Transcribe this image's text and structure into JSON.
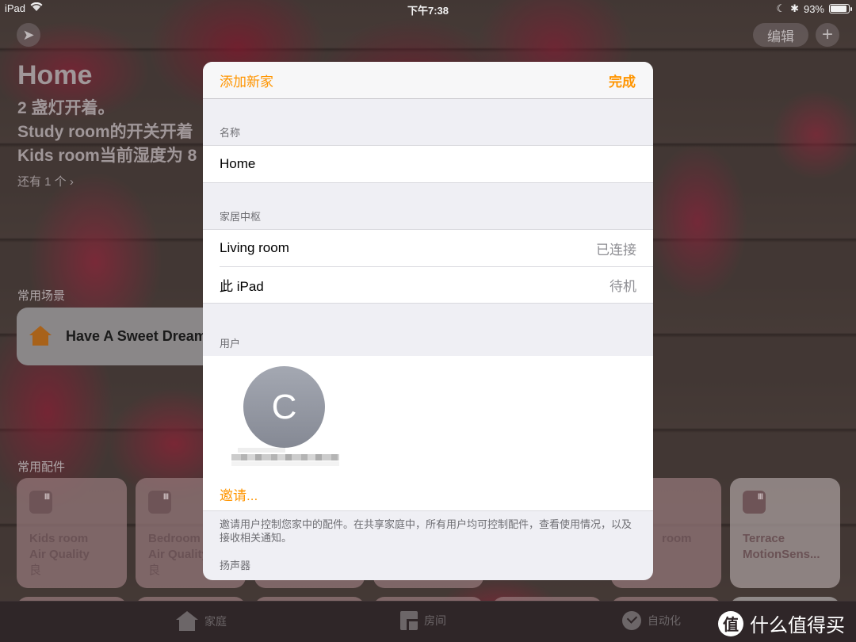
{
  "status_bar": {
    "device": "iPad",
    "time": "下午7:38",
    "battery_percent": "93%",
    "battery_level": 0.93
  },
  "home": {
    "edit_label": "编辑",
    "add_label": "+",
    "title": "Home",
    "summary": [
      "2 盏灯开着。",
      "Study room的开关开着",
      "Kids room当前湿度为 8"
    ],
    "more_label": "还有 1 个 ›",
    "scenes_header": "常用场景",
    "scenes": [
      {
        "label": "Have A Sweet Dream",
        "icon": "house-icon"
      }
    ],
    "accessories_header": "常用配件",
    "accessories": [
      {
        "name_line1": "Kids room",
        "name_line2": "Air Quality",
        "status": "良"
      },
      {
        "name_line1": "Bedroom",
        "name_line2": "Air Quality",
        "status": "良"
      },
      {
        "name_line1": "",
        "name_line2": "",
        "status": ""
      },
      {
        "name_line1": "",
        "name_line2": "",
        "status": ""
      },
      {
        "name_line1": "room",
        "name_line2": "",
        "status": ""
      },
      {
        "name_line1": "Terrace",
        "name_line2": "MotionSens...",
        "status": ""
      }
    ]
  },
  "tab_bar": {
    "tabs": [
      {
        "label": "家庭",
        "icon": "house-icon"
      },
      {
        "label": "房间",
        "icon": "room-icon"
      },
      {
        "label": "自动化",
        "icon": "automation-icon"
      }
    ],
    "watermark_badge": "值",
    "watermark_text": "什么值得买"
  },
  "modal": {
    "cancel_label": "添加新家",
    "done_label": "完成",
    "name_header": "名称",
    "name_value": "Home",
    "hub_header": "家居中枢",
    "hubs": [
      {
        "name": "Living room",
        "status": "已连接"
      },
      {
        "name": "此 iPad",
        "status": "待机"
      }
    ],
    "users_header": "用户",
    "user_avatar_initial": "C",
    "invite_label": "邀请...",
    "invite_note": "邀请用户控制您家中的配件。在共享家庭中，所有用户均可控制配件，查看使用情况，以及接收相关通知。",
    "speakers_header": "扬声器"
  },
  "colors": {
    "accent": "#ff9500",
    "grouped_bg": "#efeff4",
    "secondary_text": "#8e8e93"
  }
}
